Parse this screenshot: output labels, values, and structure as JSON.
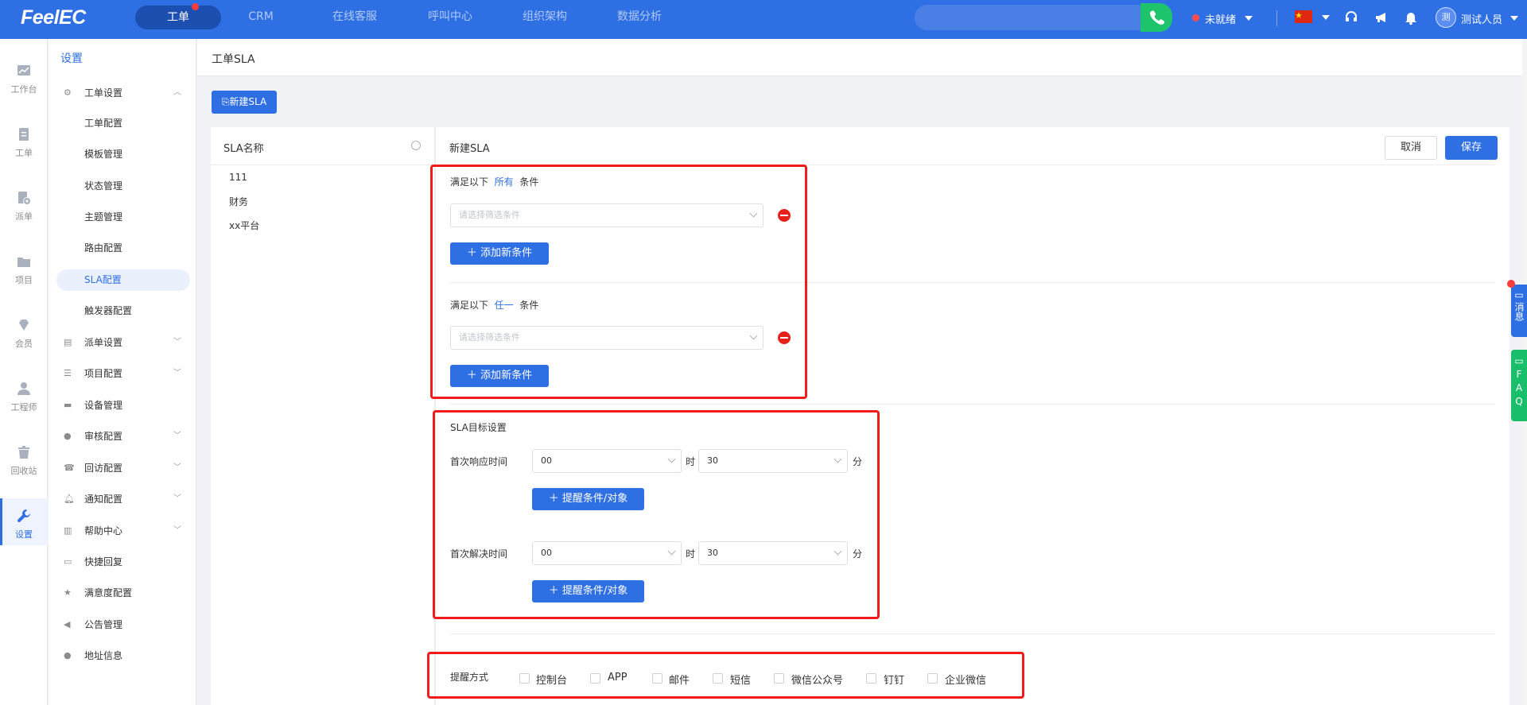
{
  "topbar": {
    "logo": "FeelEC",
    "nav": [
      "工单",
      "CRM",
      "在线客服",
      "呼叫中心",
      "组织架构",
      "数据分析"
    ],
    "status": "未就绪",
    "avatar": "测",
    "user": "测试人员"
  },
  "rail": [
    "工作台",
    "工单",
    "派单",
    "项目",
    "会员",
    "工程师",
    "回收站",
    "设置"
  ],
  "sidebar": {
    "title": "设置",
    "groups": [
      {
        "label": "工单设置",
        "children": [
          "工单配置",
          "模板管理",
          "状态管理",
          "主题管理",
          "路由配置",
          "SLA配置",
          "触发器配置"
        ]
      },
      {
        "label": "派单设置"
      },
      {
        "label": "项目配置"
      },
      {
        "label": "设备管理"
      },
      {
        "label": "审核配置"
      },
      {
        "label": "回访配置"
      },
      {
        "label": "通知配置"
      },
      {
        "label": "帮助中心"
      },
      {
        "label": "快捷回复"
      },
      {
        "label": "满意度配置"
      },
      {
        "label": "公告管理"
      },
      {
        "label": "地址信息"
      }
    ]
  },
  "page": {
    "title": "工单SLA",
    "new_button": "新建SLA"
  },
  "list": {
    "header": "SLA名称",
    "items": [
      "111",
      "财务",
      "xx平台"
    ]
  },
  "form": {
    "title": "新建SLA",
    "cancel": "取消",
    "save": "保存",
    "cond_all": {
      "pre": "满足以下",
      "key": "所有",
      "post": "条件",
      "placeholder": "请选择筛选条件",
      "add": "添加新条件"
    },
    "cond_any": {
      "pre": "满足以下",
      "key": "任一",
      "post": "条件",
      "placeholder": "请选择筛选条件",
      "add": "添加新条件"
    },
    "target": {
      "title": "SLA目标设置",
      "first_response": {
        "label": "首次响应时间",
        "hour": "00",
        "hour_unit": "时",
        "minute": "30",
        "minute_unit": "分",
        "add": "提醒条件/对象"
      },
      "first_resolve": {
        "label": "首次解决时间",
        "hour": "00",
        "hour_unit": "时",
        "minute": "30",
        "minute_unit": "分",
        "add": "提醒条件/对象"
      }
    },
    "remind": {
      "label": "提醒方式",
      "options": [
        "控制台",
        "APP",
        "邮件",
        "短信",
        "微信公众号",
        "钉钉",
        "企业微信"
      ]
    }
  },
  "float": {
    "message": "消息",
    "faq": "FAQ"
  },
  "colors": {
    "primary": "#2f6fe4",
    "alert": "#f01b1b",
    "green": "#19be6b"
  }
}
